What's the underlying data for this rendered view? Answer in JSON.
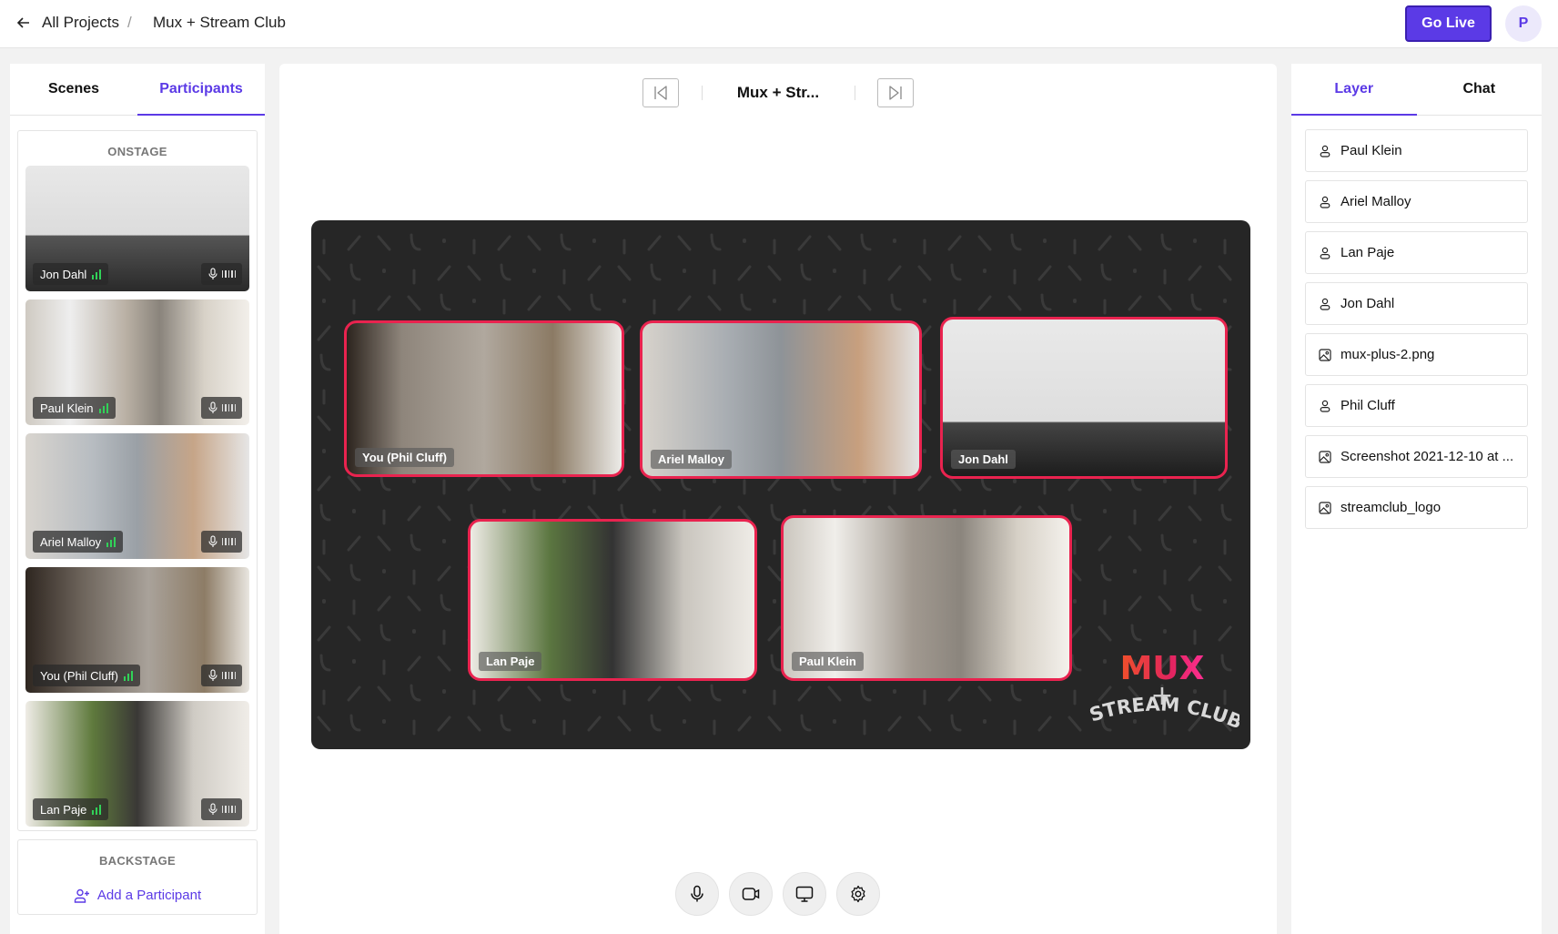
{
  "header": {
    "back_label": "All Projects",
    "separator": "/",
    "project_title": "Mux + Stream Club",
    "go_live_label": "Go Live",
    "avatar_initial": "P"
  },
  "left_panel": {
    "tabs": [
      {
        "label": "Scenes",
        "active": false
      },
      {
        "label": "Participants",
        "active": true
      }
    ],
    "onstage_title": "ONSTAGE",
    "participants": [
      {
        "name": "Jon Dahl",
        "signal": "green",
        "mic": "on"
      },
      {
        "name": "Paul Klein",
        "signal": "green",
        "mic": "on"
      },
      {
        "name": "Ariel Malloy",
        "signal": "green",
        "mic": "on"
      },
      {
        "name": "You (Phil Cluff)",
        "signal": "green",
        "mic": "on"
      },
      {
        "name": "Lan Paje",
        "signal": "green",
        "mic": "on"
      }
    ],
    "backstage_title": "BACKSTAGE",
    "add_participant_label": "Add a Participant"
  },
  "center": {
    "scene_title": "Mux + Str...",
    "stage_tiles": [
      {
        "name": "You (Phil Cluff)"
      },
      {
        "name": "Ariel Malloy"
      },
      {
        "name": "Jon Dahl"
      },
      {
        "name": "Lan Paje"
      },
      {
        "name": "Paul Klein"
      }
    ],
    "logo": {
      "line1": "MUX",
      "line2": "+",
      "line3": "STREAM CLUB"
    },
    "controls": [
      "microphone",
      "camera",
      "screen-share",
      "settings"
    ]
  },
  "right_panel": {
    "tabs": [
      {
        "label": "Layer",
        "active": true
      },
      {
        "label": "Chat",
        "active": false
      }
    ],
    "layers": [
      {
        "type": "person",
        "label": "Paul Klein"
      },
      {
        "type": "person",
        "label": "Ariel Malloy"
      },
      {
        "type": "person",
        "label": "Lan Paje"
      },
      {
        "type": "person",
        "label": "Jon Dahl"
      },
      {
        "type": "image",
        "label": "mux-plus-2.png"
      },
      {
        "type": "person",
        "label": "Phil Cluff"
      },
      {
        "type": "image",
        "label": "Screenshot 2021-12-10 at ..."
      },
      {
        "type": "image",
        "label": "streamclub_logo"
      }
    ]
  },
  "colors": {
    "accent": "#5b3ae6",
    "tile_border": "#e9234f",
    "stage_bg": "#262626",
    "signal_green": "#31d158"
  }
}
